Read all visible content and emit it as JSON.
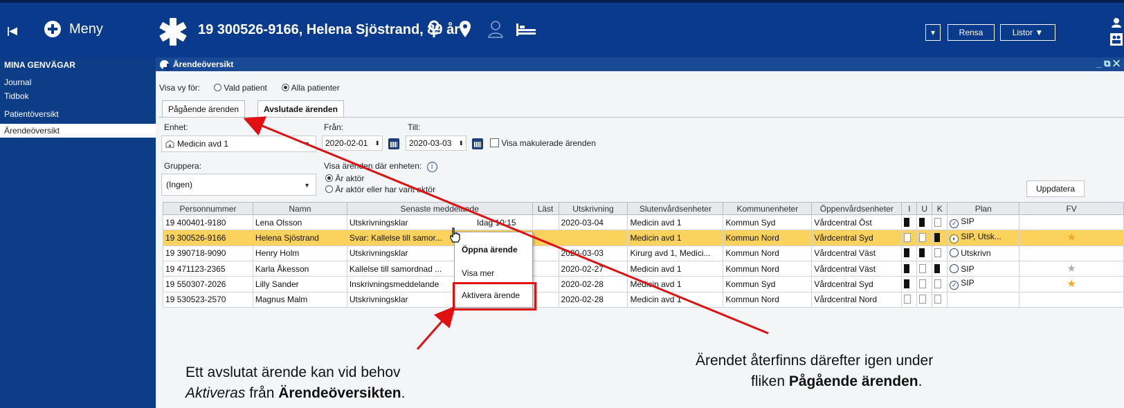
{
  "header": {
    "menu_label": "Meny",
    "patient_title": "19 300526-9166, Helena Sjöstrand, 89 år",
    "rensa_label": "Rensa",
    "listor_label": "Listor ▼"
  },
  "sidebar": {
    "heading": "MINA GENVÄGAR",
    "items": [
      {
        "label": "Journal"
      },
      {
        "label": "Tidbok"
      },
      {
        "label": "Patientöversikt"
      },
      {
        "label": "Ärendeöversikt"
      }
    ]
  },
  "panel": {
    "title": "Ärendeöversikt",
    "view_for_label": "Visa vy för:",
    "view_options": [
      "Vald patient",
      "Alla patienter"
    ],
    "tabs": [
      "Pågående ärenden",
      "Avslutade ärenden"
    ],
    "enhet_label": "Enhet:",
    "enhet_value": "Medicin avd 1",
    "fran_label": "Från:",
    "fran_value": "2020-02-01",
    "till_label": "Till:",
    "till_value": "2020-03-03",
    "makulerade_label": "Visa makulerade ärenden",
    "gruppera_label": "Gruppera:",
    "gruppera_value": "(Ingen)",
    "visa_arenden_label": "Visa ärenden där enheten:",
    "role_options": [
      "Är aktör",
      "Är aktör eller har varit aktör"
    ],
    "update_button": "Uppdatera"
  },
  "table": {
    "columns": [
      "Personnummer",
      "Namn",
      "Senaste meddelande",
      "Läst",
      "Utskrivning",
      "Slutenvårdsenheter",
      "Kommunenheter",
      "Öppenvårdsenheter",
      "I",
      "U",
      "K",
      "Plan",
      "FV"
    ],
    "rows": [
      {
        "pnr": "19 400401-9180",
        "namn": "Lena Olsson",
        "meddelande": "Utskrivningsklar",
        "tid": "Idag 10:15",
        "last": "",
        "utskrivning": "2020-03-04",
        "sluten": "Medicin avd 1",
        "kommun": "Kommun Syd",
        "oppen": "Vårdcentral Öst",
        "plan": "SIP"
      },
      {
        "pnr": "19 300526-9166",
        "namn": "Helena Sjöstrand",
        "meddelande": "Svar: Kallelse till samor...",
        "tid": "",
        "last": "",
        "utskrivning": "",
        "sluten": "Medicin avd 1",
        "kommun": "Kommun Nord",
        "oppen": "Vårdcentral Syd",
        "plan": "SIP, Utsk..."
      },
      {
        "pnr": "19 390718-9090",
        "namn": "Henry Holm",
        "meddelande": "Utskrivningsklar",
        "tid": "",
        "last": "",
        "utskrivning": "2020-03-03",
        "sluten": "Kirurg avd 1, Medici...",
        "kommun": "Kommun Nord",
        "oppen": "Vårdcentral Väst",
        "plan": "Utskrivn"
      },
      {
        "pnr": "19 471123-2365",
        "namn": "Karla Åkesson",
        "meddelande": "Kallelse till samordnad ...",
        "tid": "",
        "last": "",
        "utskrivning": "2020-02-27",
        "sluten": "Medicin avd 1",
        "kommun": "Kommun Nord",
        "oppen": "Vårdcentral Väst",
        "plan": "SIP"
      },
      {
        "pnr": "19 550307-2026",
        "namn": "Lilly Sander",
        "meddelande": "Inskrivningsmeddelande",
        "tid": "",
        "last": "",
        "utskrivning": "2020-02-28",
        "sluten": "Medicin avd 1",
        "kommun": "Kommun Syd",
        "oppen": "Vårdcentral Syd",
        "plan": "SIP"
      },
      {
        "pnr": "19 530523-2570",
        "namn": "Magnus Malm",
        "meddelande": "Utskrivningsklar",
        "tid": "",
        "last": "",
        "utskrivning": "2020-02-28",
        "sluten": "Medicin avd 1",
        "kommun": "Kommun Nord",
        "oppen": "Vårdcentral Nord",
        "plan": ""
      }
    ]
  },
  "context_menu": {
    "items": [
      "Öppna ärende",
      "Visa mer",
      "Aktivera ärende"
    ]
  },
  "annotations": {
    "left_line1": "Ett avslutat ärende kan vid behov",
    "left_line2_italic": "Aktiveras",
    "left_line2_mid": " från ",
    "left_line2_bold": "Ärendeöversikten",
    "left_line2_end": ".",
    "right_line1": "Ärendet återfinns därefter igen under",
    "right_line2_pre": "fliken ",
    "right_line2_bold": "Pågående ärenden",
    "right_line2_end": "."
  },
  "colors": {
    "header_bg": "#0a3a8c",
    "selected_row": "#fbd25c",
    "annotation_red": "#e01010",
    "star_orange": "#f5a623",
    "star_grey": "#b0b0b0"
  }
}
